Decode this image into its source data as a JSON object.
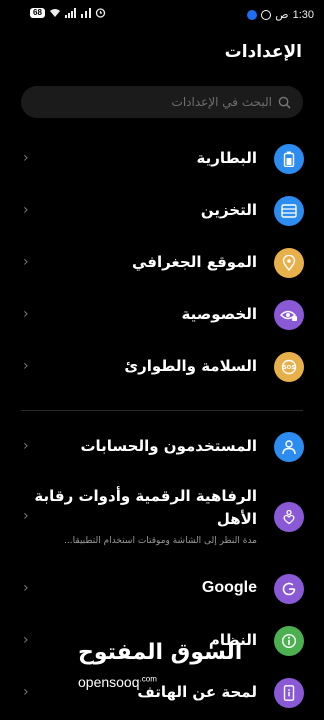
{
  "status_bar": {
    "time": "1:30",
    "period": "ص",
    "battery": "68"
  },
  "page": {
    "title": "الإعدادات"
  },
  "search": {
    "placeholder": "البحث في الإعدادات"
  },
  "settings": [
    {
      "label": "البطارية",
      "icon": "battery-icon",
      "color": "#2d8cf0"
    },
    {
      "label": "التخزين",
      "icon": "storage-icon",
      "color": "#2d8cf0"
    },
    {
      "label": "الموقع الجغرافي",
      "icon": "location-icon",
      "color": "#e8b04a"
    },
    {
      "label": "الخصوصية",
      "icon": "privacy-icon",
      "color": "#8a5ad6"
    },
    {
      "label": "السلامة والطوارئ",
      "icon": "sos-icon",
      "color": "#e8b04a"
    },
    {
      "label": "المستخدمون والحسابات",
      "icon": "user-icon",
      "color": "#2d8cf0"
    },
    {
      "label": "الرفاهية الرقمية وأدوات رقابة",
      "label2": "الأهل",
      "sub": "مدة النظر إلى الشاشة وموقتات استخدام التطبيقا...",
      "icon": "wellbeing-icon",
      "color": "#8a5ad6"
    },
    {
      "label": "Google",
      "icon": "google-icon",
      "color": "#8a5ad6"
    },
    {
      "label": "النظام",
      "icon": "system-icon",
      "color": "#4caf50"
    },
    {
      "label": "لمحة عن الهاتف",
      "icon": "phone-info-icon",
      "color": "#8a5ad6"
    }
  ],
  "watermark": {
    "arabic": "السوق المفتوح",
    "latin": "opensooq",
    "latin_suffix": ".com"
  }
}
